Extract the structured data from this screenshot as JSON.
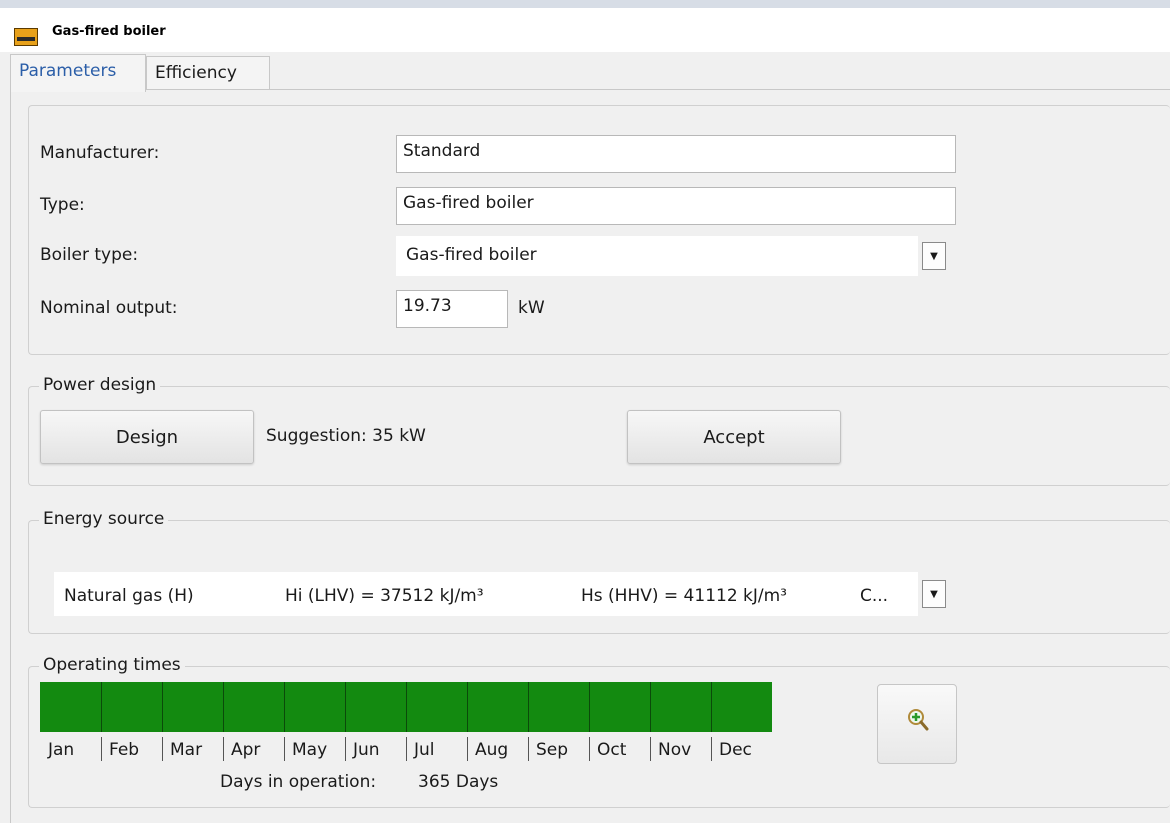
{
  "window": {
    "title": "Gas-fired boiler",
    "icon": "app-logo-icon"
  },
  "tabs": [
    {
      "label": "Parameters",
      "active": true
    },
    {
      "label": "Efficiency",
      "active": false
    }
  ],
  "parameters": {
    "manufacturer_label": "Manufacturer:",
    "manufacturer_value": "Standard",
    "type_label": "Type:",
    "type_value": "Gas-fired boiler",
    "boiler_type_label": "Boiler type:",
    "boiler_type_value": "Gas-fired boiler",
    "nominal_output_label": "Nominal output:",
    "nominal_output_value": "19.73",
    "nominal_output_unit": "kW"
  },
  "power_design": {
    "legend": "Power design",
    "design_button": "Design",
    "suggestion": "Suggestion: 35 kW",
    "accept_button": "Accept"
  },
  "energy_source": {
    "legend": "Energy source",
    "fuel": "Natural gas (H)",
    "hi": "Hi (LHV) = 37512 kJ/m³",
    "hs": "Hs (HHV) = 41112 kJ/m³",
    "more": "C..."
  },
  "operating_times": {
    "legend": "Operating times",
    "months": [
      "Jan",
      "Feb",
      "Mar",
      "Apr",
      "May",
      "Jun",
      "Jul",
      "Aug",
      "Sep",
      "Oct",
      "Nov",
      "Dec"
    ],
    "days_label": "Days in operation:",
    "days_value": "365 Days",
    "bar_color": "#138a10"
  }
}
